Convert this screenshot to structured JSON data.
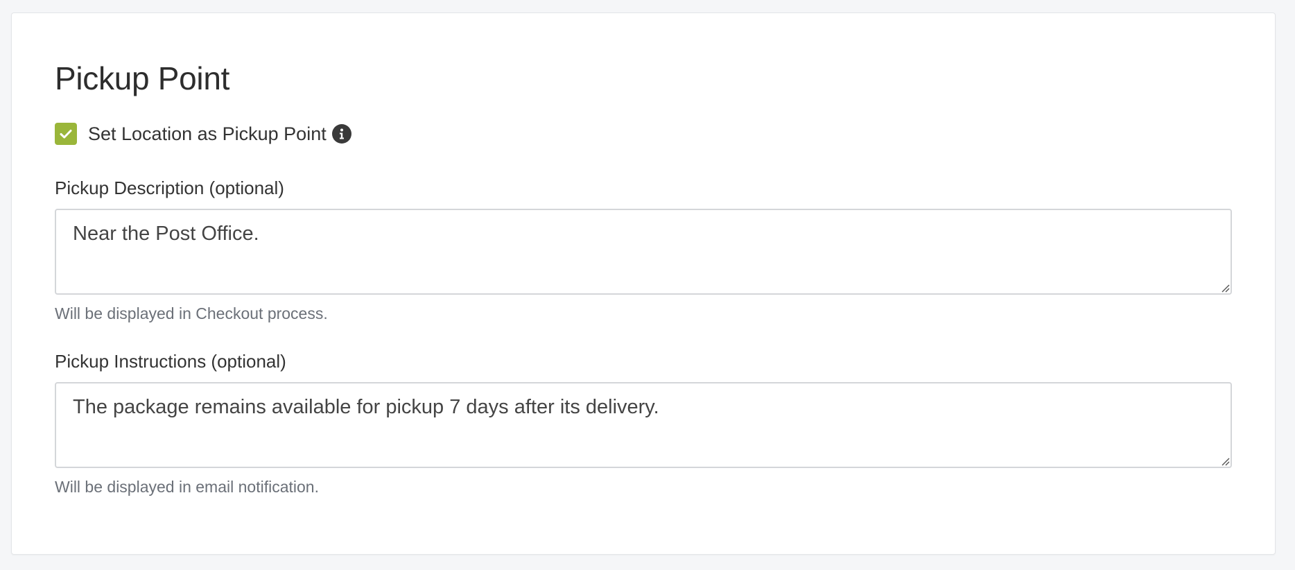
{
  "card": {
    "title": "Pickup Point"
  },
  "pickup_toggle": {
    "label": "Set Location as Pickup Point",
    "checked": true,
    "checkbox_color": "#9ab63a",
    "info_icon": "info-icon"
  },
  "description": {
    "label": "Pickup Description (optional)",
    "value": "Near the Post Office.",
    "help": "Will be displayed in Checkout process."
  },
  "instructions": {
    "label": "Pickup Instructions (optional)",
    "value": "The package remains available for pickup 7 days after its delivery.",
    "help": "Will be displayed in email notification."
  }
}
